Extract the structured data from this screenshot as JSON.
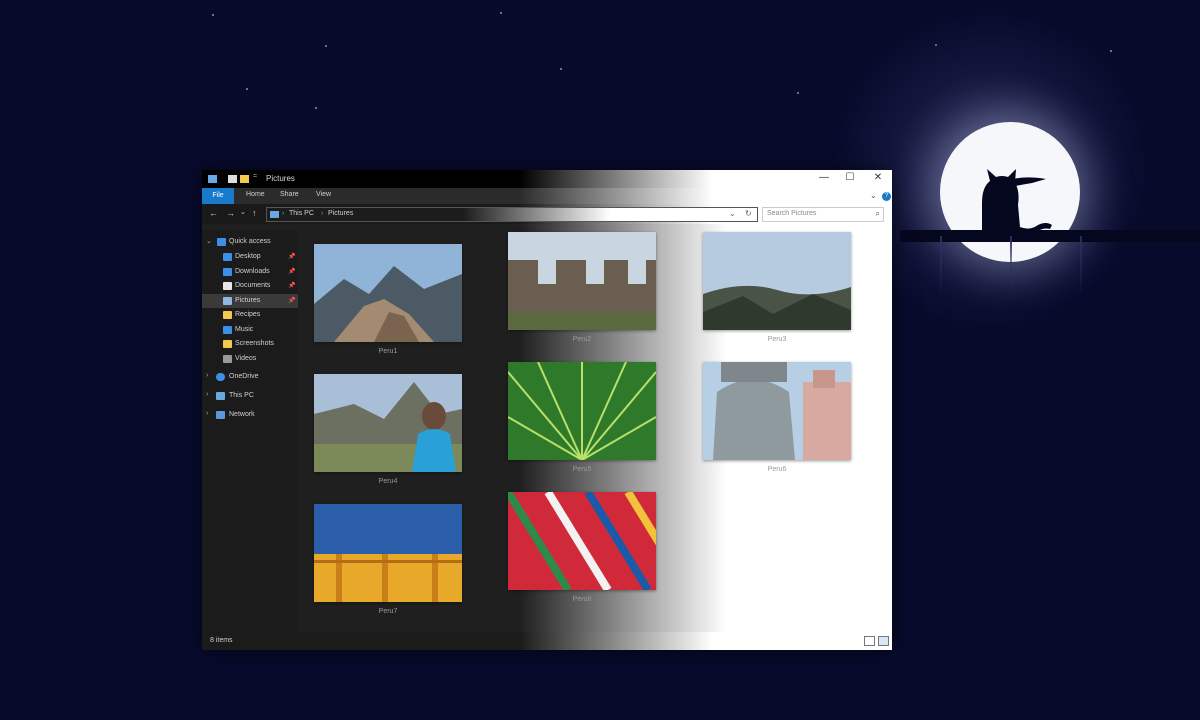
{
  "window": {
    "title": "Pictures",
    "controls": {
      "minimize": "—",
      "maximize": "☐",
      "close": "✕"
    }
  },
  "ribbon": {
    "tabs": [
      "File",
      "Home",
      "Share",
      "View"
    ],
    "expand": "⌄",
    "help": "?"
  },
  "address": {
    "back": "←",
    "forward": "→",
    "recent": "⌄",
    "up": "↑",
    "crumbs": [
      "This PC",
      "Pictures"
    ],
    "separator": "›",
    "dropdown": "⌄",
    "refresh": "↻"
  },
  "search": {
    "placeholder": "Search Pictures",
    "icon": "⌕"
  },
  "nav": {
    "quick_access": "Quick access",
    "items": [
      {
        "label": "Desktop",
        "icon": "desktop-icon",
        "color": "#3d8ee6"
      },
      {
        "label": "Downloads",
        "icon": "downloads-icon",
        "color": "#3d8ee6"
      },
      {
        "label": "Documents",
        "icon": "documents-icon",
        "color": "#e6e6e6"
      },
      {
        "label": "Pictures",
        "icon": "pictures-icon",
        "color": "#8fb8e0"
      },
      {
        "label": "Recipes",
        "icon": "folder-icon",
        "color": "#f2c94c"
      },
      {
        "label": "Music",
        "icon": "music-icon",
        "color": "#3d8ee6"
      },
      {
        "label": "Screenshots",
        "icon": "folder-icon",
        "color": "#f2c94c"
      },
      {
        "label": "Videos",
        "icon": "videos-icon",
        "color": "#9a9a9a"
      }
    ],
    "pin": "📌",
    "onedrive": "OneDrive",
    "this_pc": "This PC",
    "network": "Network",
    "selected": "Pictures"
  },
  "files": [
    {
      "name": "Peru1",
      "scene": "mountains"
    },
    {
      "name": "Peru2",
      "scene": "stone-wall"
    },
    {
      "name": "Peru3",
      "scene": "valley"
    },
    {
      "name": "Peru4",
      "scene": "machu-picchu"
    },
    {
      "name": "Peru5",
      "scene": "palm-leaf"
    },
    {
      "name": "Peru6",
      "scene": "lion-statue"
    },
    {
      "name": "Peru7",
      "scene": "yellow-wall"
    },
    {
      "name": "Peru8",
      "scene": "textile"
    }
  ],
  "status": {
    "item_count": "8 items"
  },
  "colors": {
    "accent": "#1979ca",
    "dark_bg": "#1f1f1f",
    "sky": "#070a2b"
  }
}
